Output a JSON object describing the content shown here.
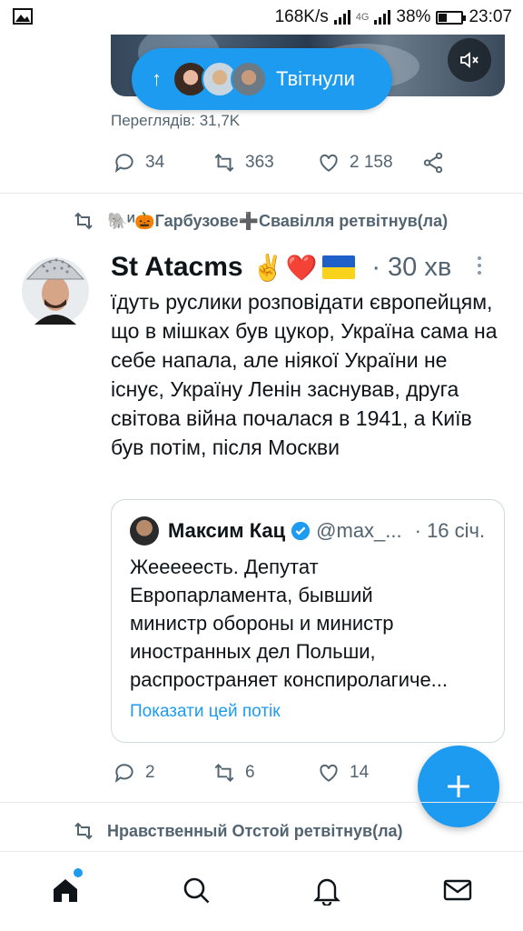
{
  "status_bar": {
    "speed": "168K/s",
    "network": "4G",
    "battery": "38%",
    "battery_level": 0.38,
    "time": "23:07"
  },
  "previous_tweet": {
    "retweeted_pill_label": "Твітнули",
    "views": "Переглядів: 31,7K",
    "replies": "34",
    "retweets": "363",
    "likes": "2 158"
  },
  "retweet_header_1": "🐘ᴻ🎃Гарбузове➕Свавілля ретвітнув(ла)",
  "tweet": {
    "author": "St Atacms",
    "emoji": "✌️❤️",
    "time": "· 30 хв",
    "text": "їдуть руслики розповідати європейцям, що в мішках був цукор, Україна сама на себе напала, але ніякої України не існує, Україну Ленін заснував, друга світова війна почалася в 1941, а Київ був потім, після Москви",
    "replies": "2",
    "retweets": "6",
    "likes": "14"
  },
  "quote": {
    "name": "Максим Кац",
    "handle": "@max_...",
    "time": "· 16 січ.",
    "text_lines": [
      "Жееееесть. Депутат",
      "Европарламента, бывший",
      "министр обороны и министр",
      "иностранных дел Польши,",
      "распространяет конспиролагиче..."
    ],
    "thread_link": "Показати цей потік"
  },
  "retweet_header_2": "Нравственный Отстой ретвітнув(ла)",
  "colors": {
    "accent": "#1d9bf0",
    "secondary_text": "#536471",
    "divider": "#e6e9eb"
  },
  "icons": {
    "nav": [
      "home-icon",
      "search-icon",
      "notifications-icon",
      "messages-icon"
    ],
    "fab": "compose-icon"
  }
}
